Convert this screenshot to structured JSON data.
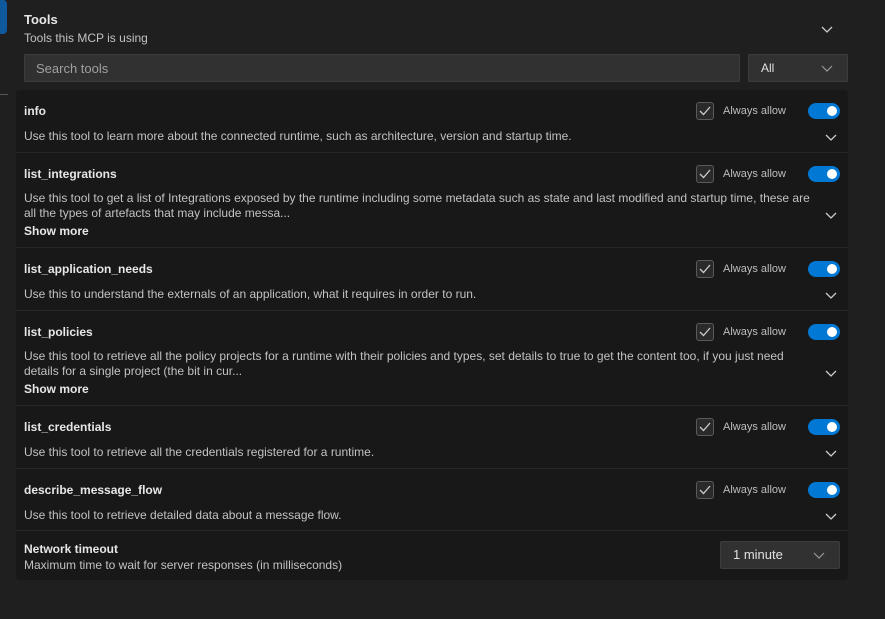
{
  "header": {
    "title": "Tools",
    "subtitle": "Tools this MCP is using"
  },
  "search": {
    "placeholder": "Search tools",
    "value": ""
  },
  "filter": {
    "selected": "All"
  },
  "tools": [
    {
      "name": "info",
      "description": "Use this tool to learn more about the connected runtime, such as architecture, version and startup time.",
      "always_allow_label": "Always allow",
      "always_allow_checked": true,
      "enabled": true
    },
    {
      "name": "list_integrations",
      "description": "Use this tool to get a list of Integrations exposed by the runtime including some metadata such as state and last modified and startup time, these are all the types of artefacts that may include messa...",
      "show_more_label": "Show more",
      "always_allow_label": "Always allow",
      "always_allow_checked": true,
      "enabled": true
    },
    {
      "name": "list_application_needs",
      "description": "Use this to understand the externals of an application, what it requires in order to run.",
      "always_allow_label": "Always allow",
      "always_allow_checked": true,
      "enabled": true
    },
    {
      "name": "list_policies",
      "description": "Use this tool to retrieve all the policy projects for a runtime with their policies and types, set details to true to get the content too, if you just need details for a single project (the bit in cur...",
      "show_more_label": "Show more",
      "always_allow_label": "Always allow",
      "always_allow_checked": true,
      "enabled": true
    },
    {
      "name": "list_credentials",
      "description": "Use this tool to retrieve all the credentials registered for a runtime.",
      "always_allow_label": "Always allow",
      "always_allow_checked": true,
      "enabled": true
    },
    {
      "name": "describe_message_flow",
      "description": "Use this tool to retrieve detailed data about a message flow.",
      "always_allow_label": "Always allow",
      "always_allow_checked": true,
      "enabled": true
    }
  ],
  "network_timeout": {
    "title": "Network timeout",
    "subtitle": "Maximum time to wait for server responses (in milliseconds)",
    "selected": "1 minute"
  },
  "colors": {
    "background": "#1f1f1f",
    "list_background": "#181818",
    "toggle_on": "#0078d4",
    "input_background": "#313131"
  }
}
